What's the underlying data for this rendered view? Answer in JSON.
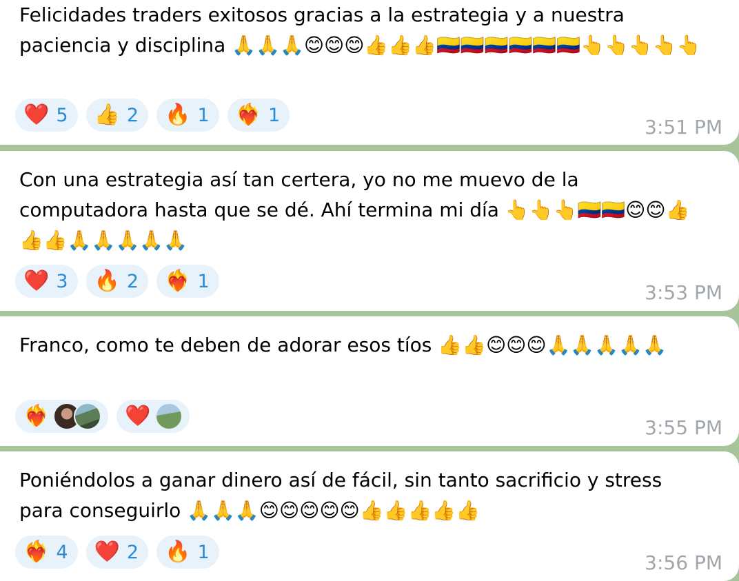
{
  "messages": [
    {
      "text": "Felicidades traders exitosos gracias a la estrategia y a nuestra paciencia y disciplina 🙏🙏🙏😊😊😊👍👍👍🇨🇴🇨🇴🇨🇴🇨🇴🇨🇴🇨🇴👆👆👆👆👆",
      "time": "3:51 PM",
      "reactions": [
        {
          "emoji": "❤️",
          "count": "5"
        },
        {
          "emoji": "👍",
          "count": "2"
        },
        {
          "emoji": "🔥",
          "count": "1"
        },
        {
          "emoji": "❤️‍🔥",
          "count": "1"
        }
      ]
    },
    {
      "text": "Con una estrategia así tan certera, yo no me muevo de la computadora hasta que se dé. Ahí termina mi día 👆👆👆🇨🇴🇨🇴😊😊👍👍👍🙏🙏🙏🙏🙏",
      "time": "3:53 PM",
      "reactions": [
        {
          "emoji": "❤️",
          "count": "3"
        },
        {
          "emoji": "🔥",
          "count": "2"
        },
        {
          "emoji": "❤️‍🔥",
          "count": "1"
        }
      ]
    },
    {
      "text": "Franco, como te deben de adorar esos tíos 👍👍😊😊😊🙏🙏🙏🙏🙏",
      "time": "3:55 PM",
      "reactions": [
        {
          "emoji": "❤️‍🔥"
        },
        {
          "emoji": "❤️"
        }
      ]
    },
    {
      "text": "Poniéndolos a ganar dinero así de fácil, sin tanto sacrificio y stress para conseguirlo 🙏🙏🙏😊😊😊😊😊👍👍👍👍👍",
      "time": "3:56 PM",
      "reactions": [
        {
          "emoji": "❤️‍🔥",
          "count": "4"
        },
        {
          "emoji": "❤️",
          "count": "2"
        },
        {
          "emoji": "🔥",
          "count": "1"
        }
      ]
    }
  ]
}
